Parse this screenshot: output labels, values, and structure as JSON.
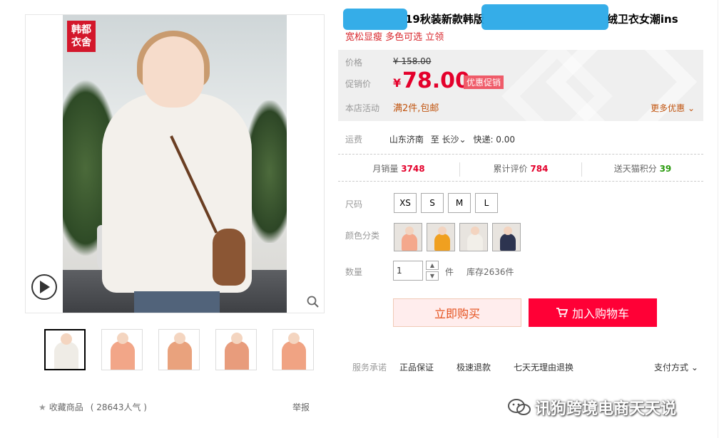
{
  "gallery": {
    "brand_logo": "韩都\n衣舍",
    "thumbnails": [
      {
        "body": "#efece6",
        "active": true
      },
      {
        "body": "#f2a688",
        "active": false
      },
      {
        "body": "#e9a27d",
        "active": false
      },
      {
        "body": "#e89c7c",
        "active": false
      },
      {
        "body": "#f0a383",
        "active": false
      }
    ],
    "favorite_label": "收藏商品",
    "favorite_count": "( 28643人气 )",
    "report_label": "举报"
  },
  "product": {
    "title": "19秋装新款韩版绒卫衣女潮ins",
    "title_prefix": "19秋装新款韩版",
    "title_suffix": "绒卫衣女潮ins",
    "subtitle": "宽松显瘦 多色可选 立领"
  },
  "price": {
    "price_label": "价格",
    "original_price": "¥ 158.00",
    "sale_label": "促销价",
    "currency": "¥",
    "sale_price": "78.00",
    "promo_tag": "优惠促销",
    "activity_label": "本店活动",
    "activity_value": "满2件,包邮",
    "more_label": "更多优惠"
  },
  "shipping": {
    "label": "运费",
    "from": "山东济南",
    "to_prefix": "至",
    "to": "长沙",
    "express": "快递: 0.00"
  },
  "stats": [
    {
      "label": "月销量",
      "value": "3748",
      "color": "red"
    },
    {
      "label": "累计评价",
      "value": "784",
      "color": "red"
    },
    {
      "label": "送天猫积分",
      "value": "39",
      "color": "green"
    }
  ],
  "options": {
    "size_label": "尺码",
    "sizes": [
      "XS",
      "S",
      "M",
      "L"
    ],
    "color_label": "颜色分类",
    "colors": [
      "#f4a88c",
      "#f0a020",
      "#f2efe9",
      "#2d3450"
    ],
    "qty_label": "数量",
    "qty_value": "1",
    "qty_unit": "件",
    "stock": "库存2636件"
  },
  "actions": {
    "buy_now": "立即购买",
    "add_cart": "加入购物车"
  },
  "service": {
    "label": "服务承诺",
    "items": [
      "正品保证",
      "极速退款",
      "七天无理由退换"
    ],
    "pay_label": "支付方式"
  },
  "watermark": "讯狗跨境电商天天说",
  "colors": {
    "accent": "#e4002b",
    "cart_bg": "#ff0036",
    "activity": "#c15510"
  }
}
